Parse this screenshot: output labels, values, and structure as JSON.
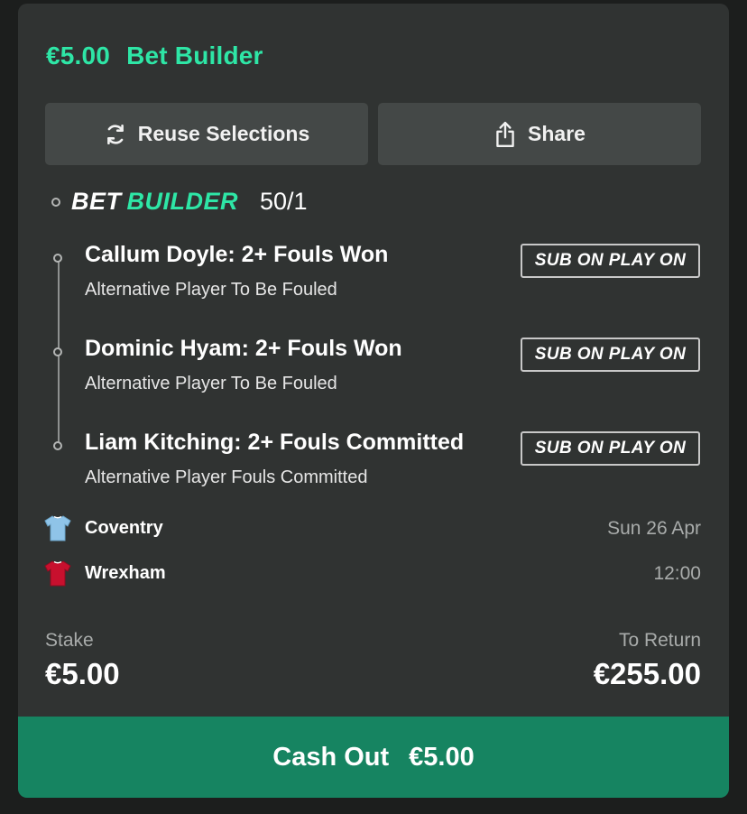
{
  "header": {
    "amount": "€5.00",
    "title": "Bet Builder"
  },
  "actions": {
    "reuse_label": "Reuse Selections",
    "share_label": "Share"
  },
  "bet_builder": {
    "logo_part1": "BET",
    "logo_part2": "BUILDER",
    "odds": "50/1"
  },
  "selections": [
    {
      "title": "Callum Doyle: 2+ Fouls Won",
      "subtitle": "Alternative Player To Be Fouled",
      "badge": "SUB ON PLAY ON"
    },
    {
      "title": "Dominic Hyam: 2+ Fouls Won",
      "subtitle": "Alternative Player To Be Fouled",
      "badge": "SUB ON PLAY ON"
    },
    {
      "title": "Liam Kitching: 2+ Fouls Committed",
      "subtitle": "Alternative Player Fouls Committed",
      "badge": "SUB ON PLAY ON"
    }
  ],
  "match": {
    "home": {
      "name": "Coventry",
      "kit_icon": "sky-blue-shirt-icon",
      "kit_color": "#8fc4e8"
    },
    "away": {
      "name": "Wrexham",
      "kit_icon": "red-shirt-icon",
      "kit_color": "#c8102e"
    },
    "date": "Sun 26 Apr",
    "time": "12:00"
  },
  "totals": {
    "stake_label": "Stake",
    "stake_value": "€5.00",
    "return_label": "To Return",
    "return_value": "€255.00"
  },
  "cashout": {
    "label": "Cash Out",
    "amount": "€5.00"
  },
  "colors": {
    "accent": "#2ee6a6",
    "card_bg": "#303332",
    "button_bg": "#444847",
    "cashout_bg": "#168461"
  }
}
